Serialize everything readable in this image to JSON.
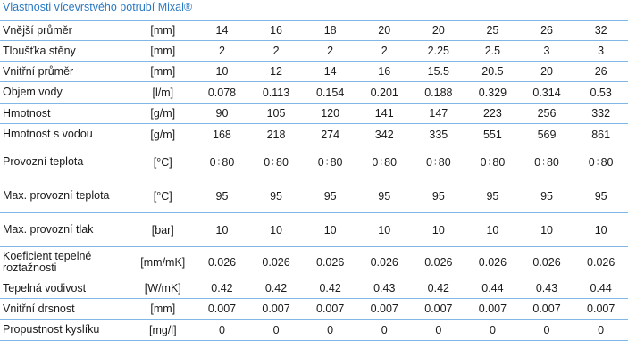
{
  "title": "Vlastnosti vícevrstvého potrubí Mixal®",
  "colors": {
    "title": "#2a78c2",
    "rule": "#7fb7e6",
    "text": "#1a1a1a"
  },
  "table": {
    "rows": [
      {
        "name": "Vnější průměr",
        "unit": "[mm]",
        "values": [
          "14",
          "16",
          "18",
          "20",
          "20",
          "25",
          "26",
          "32"
        ]
      },
      {
        "name": "Tloušťka stěny",
        "unit": "[mm]",
        "values": [
          "2",
          "2",
          "2",
          "2",
          "2.25",
          "2.5",
          "3",
          "3"
        ]
      },
      {
        "name": "Vnitřní průměr",
        "unit": "[mm]",
        "values": [
          "10",
          "12",
          "14",
          "16",
          "15.5",
          "20.5",
          "20",
          "26"
        ]
      },
      {
        "name": "Objem vody",
        "unit": "[l/m]",
        "values": [
          "0.078",
          "0.113",
          "0.154",
          "0.201",
          "0.188",
          "0.329",
          "0.314",
          "0.53"
        ]
      },
      {
        "name": "Hmotnost",
        "unit": "[g/m]",
        "values": [
          "90",
          "105",
          "120",
          "141",
          "147",
          "223",
          "256",
          "332"
        ]
      },
      {
        "name": "Hmotnost s vodou",
        "unit": "[g/m]",
        "values": [
          "168",
          "218",
          "274",
          "342",
          "335",
          "551",
          "569",
          "861"
        ]
      },
      {
        "name": "Provozní teplota",
        "unit": "[°C]",
        "values": [
          "0÷80",
          "0÷80",
          "0÷80",
          "0÷80",
          "0÷80",
          "0÷80",
          "0÷80",
          "0÷80"
        ]
      },
      {
        "name": "Max. provozní teplota",
        "unit": "[°C]",
        "values": [
          "95",
          "95",
          "95",
          "95",
          "95",
          "95",
          "95",
          "95"
        ]
      },
      {
        "name": "Max. provozní tlak",
        "unit": "[bar]",
        "values": [
          "10",
          "10",
          "10",
          "10",
          "10",
          "10",
          "10",
          "10"
        ]
      },
      {
        "name": "Koeficient tepelné roztažnosti",
        "unit": "[mm/mK]",
        "values": [
          "0.026",
          "0.026",
          "0.026",
          "0.026",
          "0.026",
          "0.026",
          "0.026",
          "0.026"
        ]
      },
      {
        "name": "Tepelná vodivost",
        "unit": "[W/mK]",
        "values": [
          "0.42",
          "0.42",
          "0.42",
          "0.43",
          "0.42",
          "0.44",
          "0.43",
          "0.44"
        ]
      },
      {
        "name": "Vnitřní drsnost",
        "unit": "[mm]",
        "values": [
          "0.007",
          "0.007",
          "0.007",
          "0.007",
          "0.007",
          "0.007",
          "0.007",
          "0.007"
        ]
      },
      {
        "name": "Propustnost kyslíku",
        "unit": "[mg/l]",
        "values": [
          "0",
          "0",
          "0",
          "0",
          "0",
          "0",
          "0",
          "0"
        ]
      }
    ]
  }
}
